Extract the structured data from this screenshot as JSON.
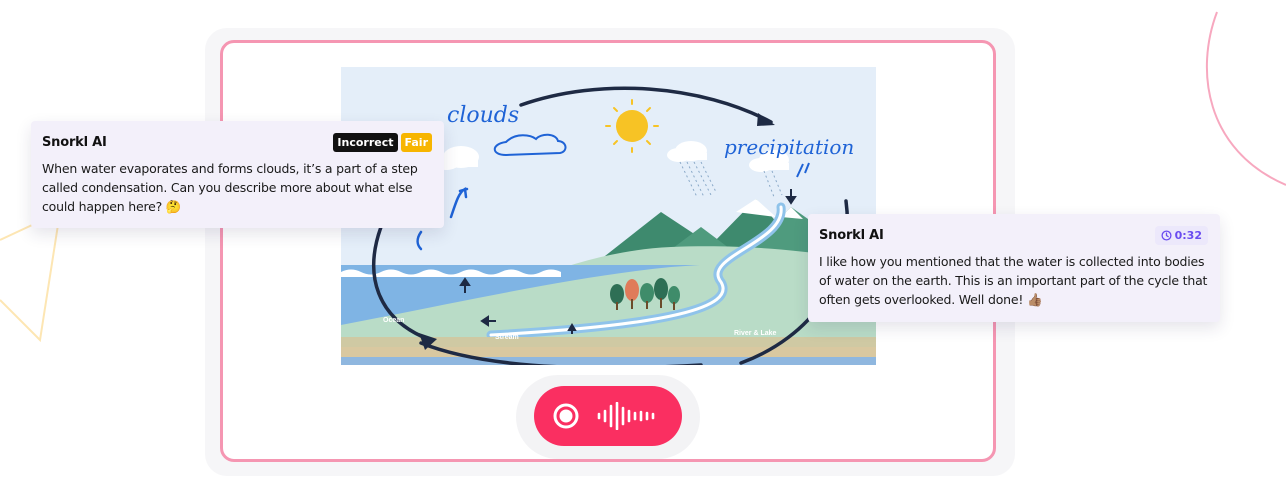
{
  "colors": {
    "frame_border": "#f596b2",
    "card_bg": "#f3f0fa",
    "record_button": "#fa2f61",
    "badge_incorrect": "#111111",
    "badge_fair": "#f7b500",
    "timer_accent": "#6a4cf0",
    "handwriting": "#1f63d6"
  },
  "scene": {
    "handwritten": {
      "clouds": "clouds",
      "precipitation": "precipitation"
    },
    "labels": {
      "ocean": "Ocean",
      "stream": "Stream",
      "river_lake": "River & Lake"
    }
  },
  "feedback_left": {
    "title": "Snorkl AI",
    "badge_incorrect": "Incorrect",
    "badge_fair": "Fair",
    "text": "When water evaporates and forms clouds, it’s a part of a step called condensation. Can you describe more about what else could happen here? 🤔"
  },
  "feedback_right": {
    "title": "Snorkl AI",
    "timer": "0:32",
    "text": "I like how you mentioned that the water is collected into bodies of water on the earth. This is an important part of the cycle that often gets overlooked. Well done! 👍🏽"
  },
  "icons": {
    "record": "record-icon",
    "waveform": "waveform-icon",
    "clock": "clock-icon",
    "sun": "sun-icon"
  }
}
